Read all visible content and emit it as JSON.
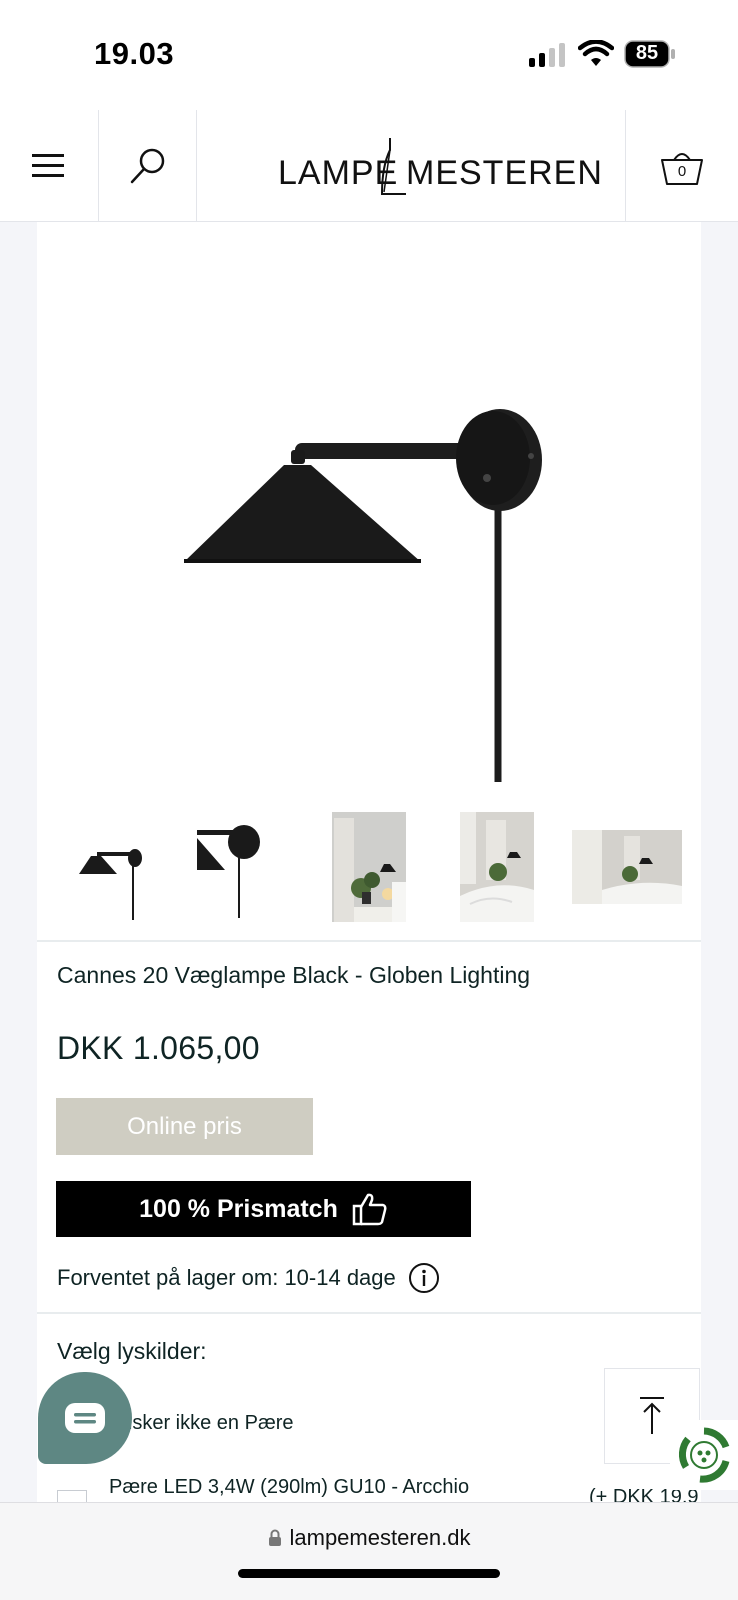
{
  "status_bar": {
    "time": "19.03",
    "battery": "85"
  },
  "header": {
    "logo_left": "LAMPE",
    "logo_right": "MESTEREN",
    "cart_count": "0"
  },
  "product": {
    "title": "Cannes 20 Væglampe Black - Globen Lighting",
    "price": "DKK 1.065,00",
    "online_badge": "Online pris",
    "prismatch_label": "100 % Prismatch",
    "stock_text": "Forventet på lager om: 10-14 dage"
  },
  "light_sources": {
    "heading": "Vælg lyskilder:",
    "options": [
      {
        "label": "ønsker ikke en Pære"
      },
      {
        "label": "Pære LED 3,4W (290lm) GU10 - Arcchio",
        "price": "(+ DKK 19,9"
      }
    ]
  },
  "browser": {
    "url": "lampemesteren.dk"
  },
  "colors": {
    "accent_teal": "#5e8783",
    "online_badge_bg": "#cfcdc2",
    "eco_badge_green": "#2f7a32"
  }
}
